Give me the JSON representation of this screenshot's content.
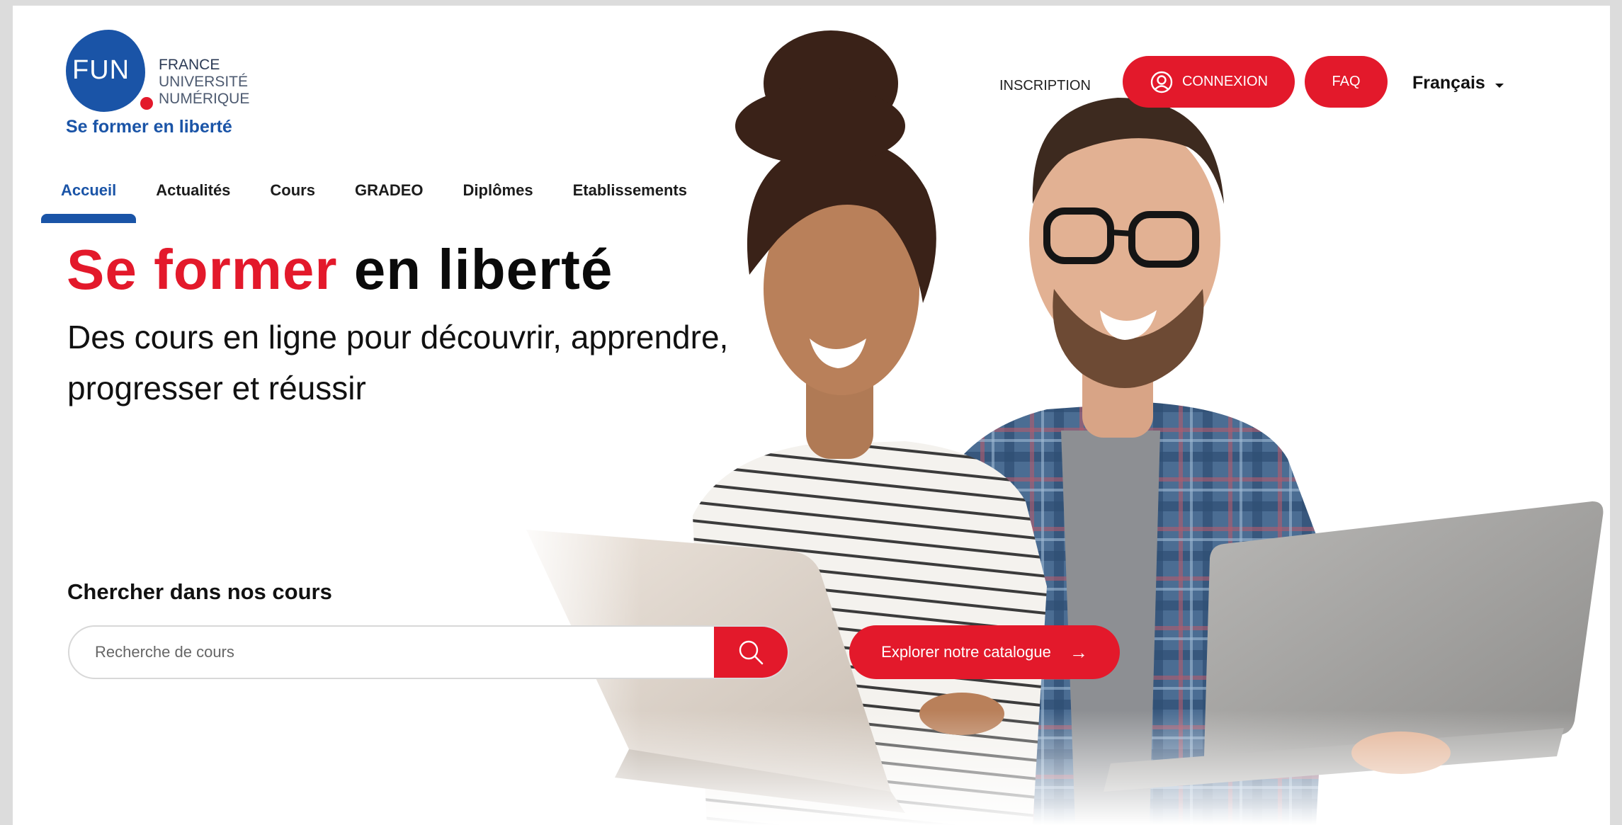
{
  "logo": {
    "abbr": "FUN",
    "lines": [
      "FRANCE",
      "UNIVERSITÉ",
      "NUMÉRIQUE"
    ],
    "tagline": "Se former en liberté"
  },
  "header": {
    "inscription": "INSCRIPTION",
    "connexion": "CONNEXION",
    "faq": "FAQ",
    "language": "Français"
  },
  "nav": {
    "items": [
      "Accueil",
      "Actualités",
      "Cours",
      "GRADEO",
      "Diplômes",
      "Etablissements"
    ],
    "active": "Accueil"
  },
  "hero": {
    "headline_red": "Se former",
    "headline_dark": "en liberté",
    "subtitle": "Des cours en ligne pour découvrir, apprendre, progresser et réussir"
  },
  "search": {
    "title": "Chercher dans nos cours",
    "placeholder": "Recherche de cours"
  },
  "catalog": {
    "label": "Explorer notre catalogue",
    "arrow": "→"
  },
  "colors": {
    "brand_blue": "#1a54a7",
    "brand_red": "#e3192b"
  },
  "icons": {
    "connexion": "user-circle-icon",
    "search": "search-icon",
    "language_caret": "caret-down-icon"
  }
}
